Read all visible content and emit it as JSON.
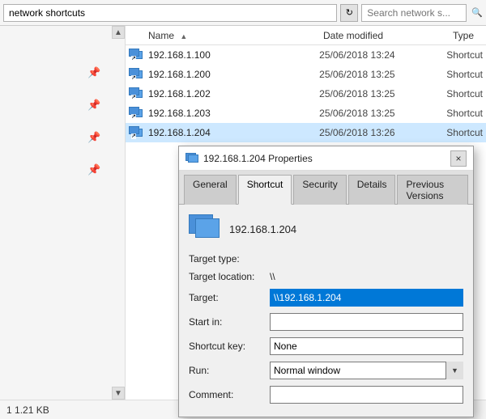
{
  "addressBar": {
    "path": "network shortcuts",
    "refreshTitle": "Refresh",
    "searchPlaceholder": "Search network s..."
  },
  "fileList": {
    "headers": {
      "name": "Name",
      "sortArrow": "▲",
      "dateModified": "Date modified",
      "type": "Type"
    },
    "files": [
      {
        "name": "192.168.1.100",
        "date": "25/06/2018 13:24",
        "type": "Shortcut"
      },
      {
        "name": "192.168.1.200",
        "date": "25/06/2018 13:25",
        "type": "Shortcut"
      },
      {
        "name": "192.168.1.202",
        "date": "25/06/2018 13:25",
        "type": "Shortcut"
      },
      {
        "name": "192.168.1.203",
        "date": "25/06/2018 13:25",
        "type": "Shortcut"
      },
      {
        "name": "192.168.1.204",
        "date": "25/06/2018 13:26",
        "type": "Shortcut"
      }
    ]
  },
  "statusBar": {
    "text": "1.21 KB"
  },
  "dialog": {
    "title": "192.168.1.204 Properties",
    "closeBtn": "×",
    "tabs": [
      "General",
      "Shortcut",
      "Security",
      "Details",
      "Previous Versions"
    ],
    "activeTab": "Shortcut",
    "shortcutName": "192.168.1.204",
    "fields": {
      "targetType": {
        "label": "Target type:",
        "value": ""
      },
      "targetLocation": {
        "label": "Target location:",
        "value": "\\\\"
      },
      "target": {
        "label": "Target:",
        "value": "\\\\192.168.1.204"
      },
      "startIn": {
        "label": "Start in:",
        "value": ""
      },
      "shortcutKey": {
        "label": "Shortcut key:",
        "value": "None"
      },
      "run": {
        "label": "Run:",
        "value": "Normal window"
      },
      "comment": {
        "label": "Comment:",
        "value": ""
      }
    }
  }
}
